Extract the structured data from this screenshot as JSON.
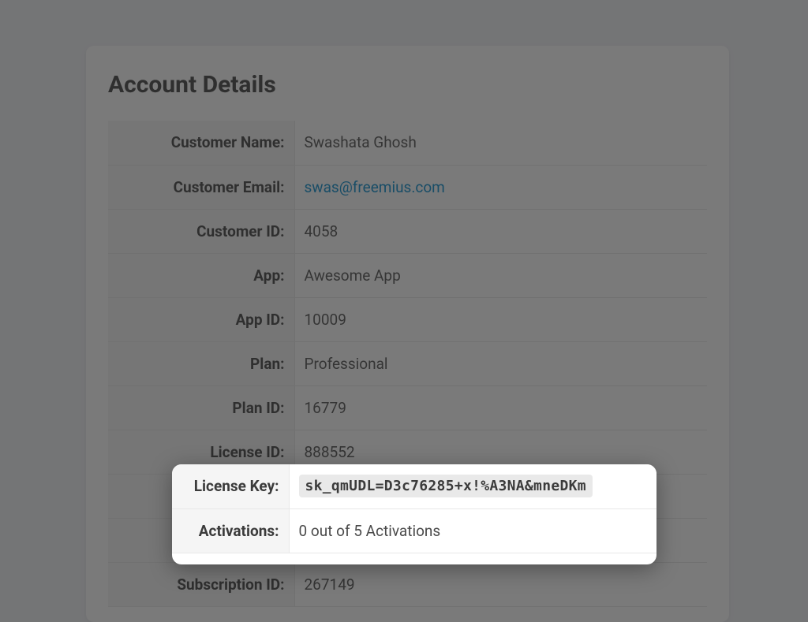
{
  "card": {
    "title": "Account Details",
    "rows": [
      {
        "label": "Customer Name:",
        "value": "Swashata Ghosh"
      },
      {
        "label": "Customer Email:",
        "value": "swas@freemius.com",
        "link": true
      },
      {
        "label": "Customer ID:",
        "value": "4058"
      },
      {
        "label": "App:",
        "value": "Awesome App"
      },
      {
        "label": "App ID:",
        "value": "10009"
      },
      {
        "label": "Plan:",
        "value": "Professional"
      },
      {
        "label": "Plan ID:",
        "value": "16779"
      },
      {
        "label": "License ID:",
        "value": "888552"
      },
      {
        "label": "License Key:",
        "value": "sk_qmUDL=D3c76285+x!%A3NA&mneDKm",
        "pill": true
      },
      {
        "label": "Activations:",
        "value": "0 out of 5 Activations"
      },
      {
        "label": "Subscription ID:",
        "value": "267149"
      }
    ]
  },
  "highlight": {
    "row_indices": [
      8,
      9
    ]
  }
}
